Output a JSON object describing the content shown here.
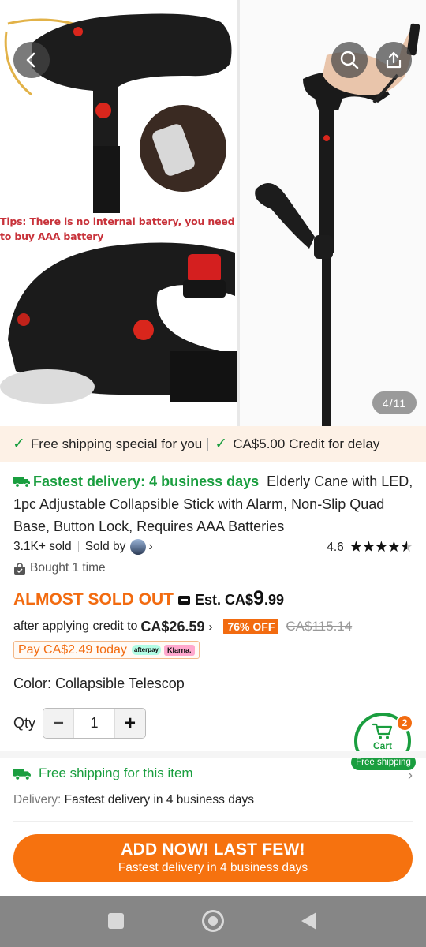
{
  "gallery": {
    "tips_text": "Tips: There is no internal battery, you need to buy AAA battery",
    "counter": "4/11",
    "back_icon": "chevron-left-icon",
    "search_icon": "search-icon",
    "share_icon": "share-icon"
  },
  "benefits": {
    "item1": "Free shipping special for you",
    "item2": "CA$5.00 Credit for delay"
  },
  "product": {
    "fast_delivery": "Fastest delivery: 4 business days",
    "title": "Elderly Cane with LED, 1pc Adjustable Collapsible Stick with Alarm, Non-Slip Quad Base, Button Lock, Requires AAA Batteries",
    "sold": "3.1K+ sold",
    "sold_by": "Sold by",
    "rating": "4.6",
    "bought": "Bought 1 time"
  },
  "price": {
    "almost": "ALMOST SOLD OUT",
    "est_prefix": "Est. CA$",
    "est_int": "9",
    "est_dec": ".99",
    "credit_text": "after applying credit to",
    "credit_price": "CA$26.59",
    "off": "76% OFF",
    "original": "CA$115.14",
    "pay_today": "Pay CA$2.49 today",
    "afterpay": "afterpay",
    "klarna": "Klarna."
  },
  "color": {
    "label": "Color:",
    "value": "Collapsible Telescop"
  },
  "qty": {
    "label": "Qty",
    "value": "1"
  },
  "cart": {
    "label": "Cart",
    "count": "2",
    "ship": "Free shipping"
  },
  "shipping": {
    "title": "Free shipping for this item",
    "delivery_label": "Delivery:",
    "delivery_value": "Fastest delivery in 4 business days"
  },
  "cta": {
    "main": "ADD NOW! LAST FEW!",
    "sub": "Fastest delivery in 4 business days"
  },
  "colors": {
    "accent_orange": "#f6720f",
    "success_green": "#1a9e3f",
    "benefit_bg": "#fdf1e6"
  }
}
